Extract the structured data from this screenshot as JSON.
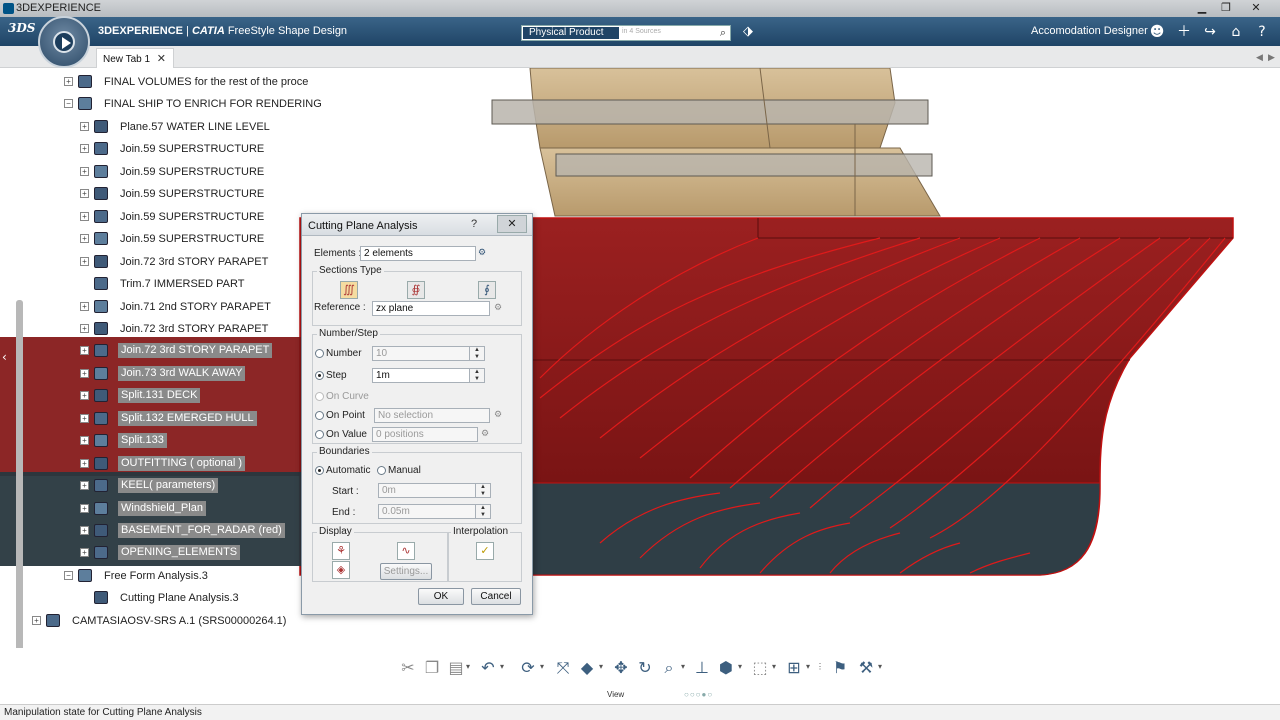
{
  "window": {
    "title": "3DEXPERIENCE"
  },
  "appbar": {
    "brand_main": "3DEXPERIENCE",
    "brand_sep": " | ",
    "brand_catia": "CATIA",
    "brand_app": " FreeStyle Shape Design",
    "search_product": "Physical Product",
    "search_sources": "in 4 Sources",
    "user_role": "Accomodation Designer"
  },
  "tabs": {
    "active_label": "New Tab 1"
  },
  "tree": {
    "nodes": [
      {
        "label": "FINAL VOLUMES for the rest of the proce",
        "level": 0
      },
      {
        "label": "FINAL SHIP TO ENRICH FOR RENDERING",
        "level": 0
      },
      {
        "label": "Plane.57 WATER LINE LEVEL",
        "level": 1
      },
      {
        "label": "Join.59 SUPERSTRUCTURE",
        "level": 1
      },
      {
        "label": "Join.59 SUPERSTRUCTURE",
        "level": 1
      },
      {
        "label": "Join.59 SUPERSTRUCTURE",
        "level": 1
      },
      {
        "label": "Join.59 SUPERSTRUCTURE",
        "level": 1
      },
      {
        "label": "Join.59 SUPERSTRUCTURE",
        "level": 1
      },
      {
        "label": "Join.72 3rd STORY PARAPET",
        "level": 1
      },
      {
        "label": "Trim.7 IMMERSED PART",
        "level": 1
      },
      {
        "label": "Join.71 2nd STORY PARAPET",
        "level": 1
      },
      {
        "label": "Join.72 3rd STORY PARAPET",
        "level": 1
      },
      {
        "label": "Join.72 3rd STORY PARAPET",
        "level": 1,
        "selected": true
      },
      {
        "label": "Join.73 3rd WALK AWAY",
        "level": 1,
        "selected": true
      },
      {
        "label": "Split.131 DECK",
        "level": 1,
        "selected": true
      },
      {
        "label": "Split.132 EMERGED HULL",
        "level": 1,
        "selected": true
      },
      {
        "label": "Split.133",
        "level": 1,
        "selected": true
      },
      {
        "label": "OUTFITTING ( optional )",
        "level": 1,
        "selected": true
      },
      {
        "label": "KEEL( parameters)",
        "level": 1,
        "selected": true
      },
      {
        "label": "Windshield_Plan",
        "level": 1,
        "selected": true
      },
      {
        "label": "BASEMENT_FOR_RADAR (red)",
        "level": 1,
        "selected": true
      },
      {
        "label": "OPENING_ELEMENTS",
        "level": 1,
        "selected": true
      },
      {
        "label": "Free Form Analysis.3",
        "level": 0
      },
      {
        "label": "Cutting Plane Analysis.3",
        "level": 1
      },
      {
        "label": "CAMTASIAOSV-SRS A.1 (SRS00000264.1)",
        "level": -1
      }
    ]
  },
  "dialog": {
    "title": "Cutting Plane Analysis",
    "help": "?",
    "close": "✕",
    "elements_label": "Elements :",
    "elements_value": "2 elements",
    "sections_type_label": "Sections Type",
    "reference_label": "Reference :",
    "reference_value": "zx plane",
    "number_step_label": "Number/Step",
    "number_label": "Number",
    "number_value": "10",
    "step_label": "Step",
    "step_value": "1m",
    "on_curve_label": "On Curve",
    "on_point_label": "On Point",
    "on_point_value": "No selection",
    "on_value_label": "On Value",
    "on_value_value": "0 positions",
    "boundaries_label": "Boundaries",
    "automatic_label": "Automatic",
    "manual_label": "Manual",
    "start_label": "Start :",
    "start_value": "0m",
    "end_label": "End :",
    "end_value": "0.05m",
    "display_label": "Display",
    "interpolation_label": "Interpolation",
    "settings_label": "Settings...",
    "ok_label": "OK",
    "cancel_label": "Cancel"
  },
  "bottom": {
    "view_label": "View"
  },
  "status": {
    "text": "Manipulation state for Cutting Plane Analysis"
  },
  "colors": {
    "hull_red": "#8b1a1a",
    "hull_dark": "#2f3e46",
    "superstructure": "#c9ad82",
    "appbar": "#1f4466"
  }
}
